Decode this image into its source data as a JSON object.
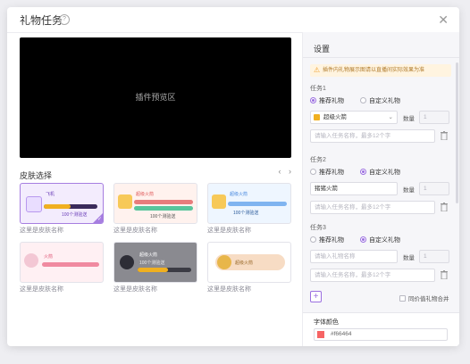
{
  "dialog": {
    "title": "礼物任务",
    "help_glyph": "?",
    "close_glyph": "✕"
  },
  "preview": {
    "label": "插件预览区"
  },
  "skins": {
    "title": "皮肤选择",
    "prev_glyph": "‹",
    "next_glyph": "›",
    "items": [
      {
        "name": "这里是皮肤名称",
        "selected": true,
        "theme": "purple",
        "card_title": "飞机",
        "badge": "100个测验送"
      },
      {
        "name": "这里是皮肤名称",
        "selected": false,
        "theme": "green",
        "card_title": "超级火箭",
        "badge": "100个测验送"
      },
      {
        "name": "这里是皮肤名称",
        "selected": false,
        "theme": "blue",
        "card_title": "超级火箭",
        "badge": "100个测验送"
      },
      {
        "name": "这里是皮肤名称",
        "selected": false,
        "theme": "pink",
        "card_title": "火箭",
        "badge": ""
      },
      {
        "name": "这里是皮肤名称",
        "selected": false,
        "theme": "dark",
        "card_title": "超级火箭",
        "badge": "100个测验送"
      },
      {
        "name": "这里是皮肤名称",
        "selected": false,
        "theme": "gold",
        "card_title": "超级火箭",
        "badge": ""
      }
    ]
  },
  "settings": {
    "title": "设置",
    "warning": "插件内礼物展示图请以直播间实际效果为准",
    "tasks": [
      {
        "label": "任务1",
        "opt_recommend": "推荐礼物",
        "opt_custom": "自定义礼物",
        "selected": "recommend",
        "gift_value": "超级火箭",
        "gift_placeholder": "",
        "qty_label": "数量",
        "qty_value": "1",
        "name_placeholder": "请输入任务名称，最多12个字"
      },
      {
        "label": "任务2",
        "opt_recommend": "推荐礼物",
        "opt_custom": "自定义礼物",
        "selected": "custom",
        "gift_value": "猪猪火箭",
        "gift_placeholder": "",
        "qty_label": "数量",
        "qty_value": "1",
        "name_placeholder": "请输入任务名称，最多12个字"
      },
      {
        "label": "任务3",
        "opt_recommend": "推荐礼物",
        "opt_custom": "自定义礼物",
        "selected": "custom",
        "gift_value": "",
        "gift_placeholder": "请输入礼物名称",
        "qty_label": "数量",
        "qty_value": "1",
        "name_placeholder": "请输入任务名称，最多12个字"
      }
    ],
    "add_glyph": "+",
    "merge_label": "同价值礼物合并",
    "font_color_label": "字体颜色",
    "font_color_value": "#f66464"
  }
}
